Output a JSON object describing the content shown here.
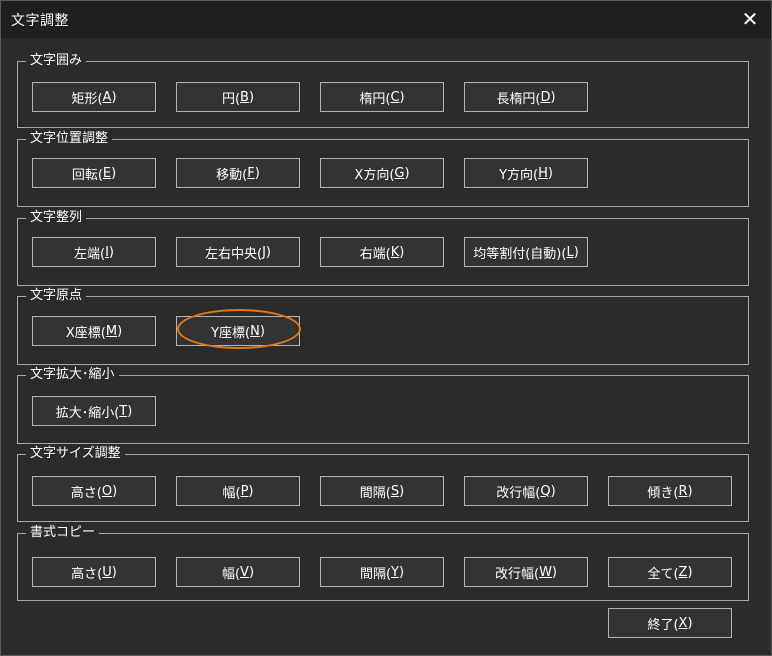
{
  "window": {
    "title": "文字調整",
    "close_icon": "close-icon",
    "close_glyph": "✕"
  },
  "groups": [
    {
      "label": "文字囲み",
      "buttons": [
        "矩形(A)",
        "円(B)",
        "楕円(C)",
        "長楕円(D)"
      ]
    },
    {
      "label": "文字位置調整",
      "buttons": [
        "回転(E)",
        "移動(F)",
        "X方向(G)",
        "Y方向(H)"
      ]
    },
    {
      "label": "文字整列",
      "buttons": [
        "左端(I)",
        "左右中央(J)",
        "右端(K)",
        "均等割付(自動)(L)"
      ]
    },
    {
      "label": "文字原点",
      "buttons": [
        "X座標(M)",
        "Y座標(N)"
      ]
    },
    {
      "label": "文字拡大･縮小",
      "buttons": [
        "拡大･縮小(T)"
      ]
    },
    {
      "label": "文字サイズ調整",
      "buttons": [
        "高さ(O)",
        "幅(P)",
        "間隔(S)",
        "改行幅(Q)",
        "傾き(R)"
      ]
    },
    {
      "label": "書式コピー",
      "buttons": [
        "高さ(U)",
        "幅(V)",
        "間隔(Y)",
        "改行幅(W)",
        "全て(Z)"
      ]
    }
  ],
  "footer": {
    "exit_button": "終了(X)"
  },
  "annotation": {
    "highlight_color": "#e07820"
  }
}
